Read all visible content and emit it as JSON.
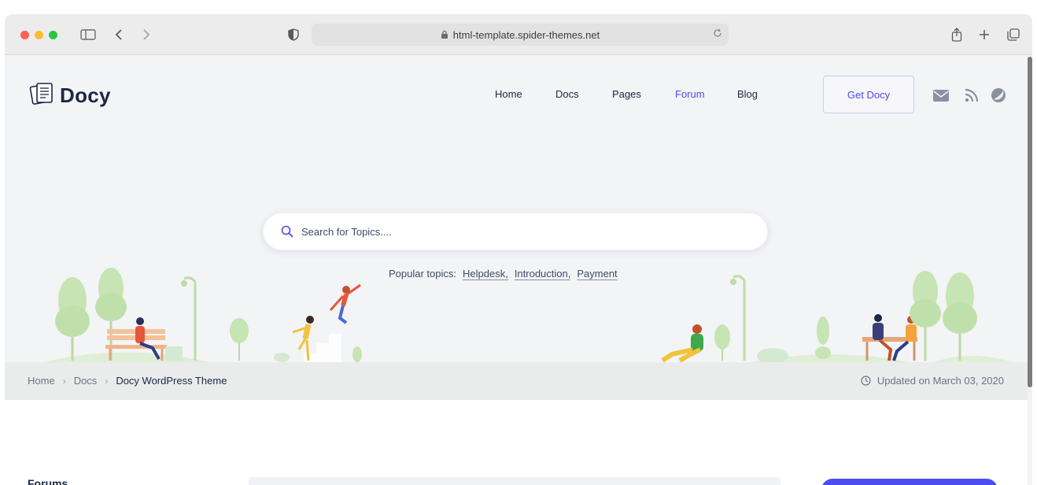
{
  "browser": {
    "url": "html-template.spider-themes.net",
    "icons": [
      "sidebar-icon",
      "back-icon",
      "forward-icon",
      "shield-icon",
      "lock-icon",
      "reload-icon",
      "share-icon",
      "new-tab-icon",
      "tabs-overview-icon"
    ]
  },
  "header": {
    "logo_text": "Docy",
    "nav": [
      {
        "label": "Home",
        "active": false
      },
      {
        "label": "Docs",
        "active": false
      },
      {
        "label": "Pages",
        "active": false
      },
      {
        "label": "Forum",
        "active": true
      },
      {
        "label": "Blog",
        "active": false
      }
    ],
    "cta_label": "Get Docy",
    "social_icons": [
      "mail-icon",
      "rss-icon",
      "theme-toggle-icon"
    ]
  },
  "hero": {
    "search_placeholder": "Search for Topics....",
    "popular_label": "Popular topics:",
    "popular_topics": [
      "Helpdesk,",
      "Introduction,",
      "Payment"
    ]
  },
  "breadcrumb": {
    "items": [
      "Home",
      "Docs",
      "Docy WordPress Theme"
    ],
    "updated": "Updated on March 03, 2020"
  },
  "content": {
    "forums_label": "Forums"
  },
  "colors": {
    "accent": "#4c4cf1",
    "text": "#1d2746",
    "hero_bg": "#f3f4f6",
    "breadcrumb_bg": "#eaecec",
    "tree_green": "#c6e4b4"
  }
}
